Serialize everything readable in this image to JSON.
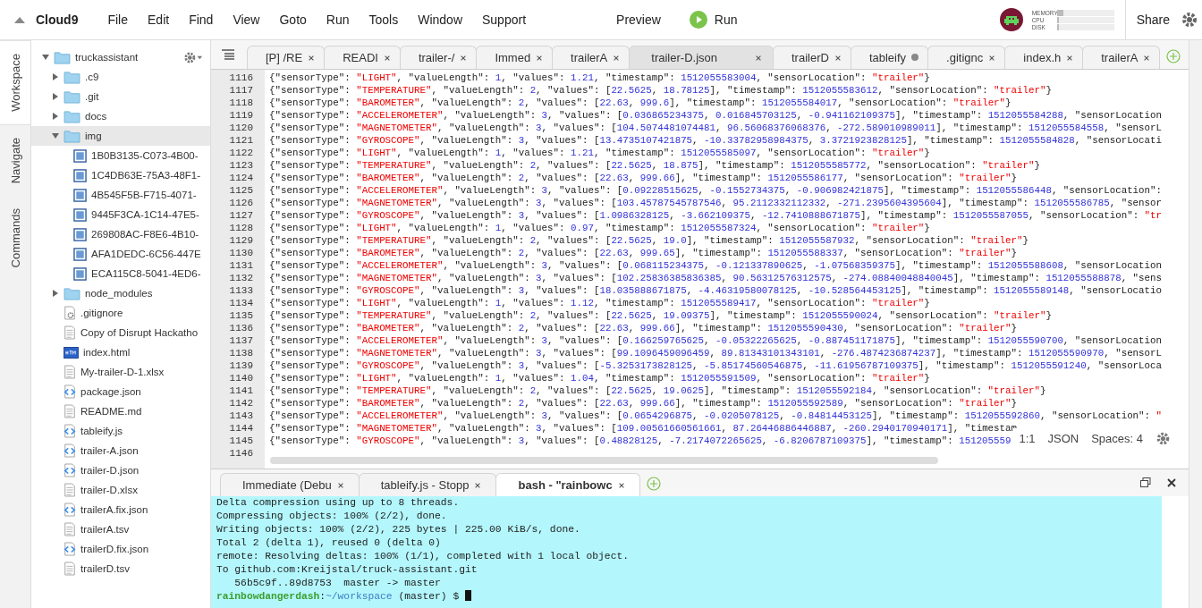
{
  "menubar": {
    "logo": "Cloud9",
    "items": [
      "File",
      "Edit",
      "Find",
      "View",
      "Goto",
      "Run",
      "Tools",
      "Window",
      "Support"
    ],
    "preview": "Preview",
    "run": "Run",
    "meters": [
      {
        "label": "MEMORY",
        "level": 0.12
      },
      {
        "label": "CPU",
        "level": 0.04
      },
      {
        "label": "DISK",
        "level": 0.03
      }
    ],
    "share": "Share"
  },
  "side_tabs": [
    {
      "label": "Workspace",
      "selected": true
    },
    {
      "label": "Navigate",
      "selected": false
    },
    {
      "label": "Commands",
      "selected": false
    }
  ],
  "file_tree": [
    {
      "name": "truckassistant",
      "kind": "folder",
      "expanded": true,
      "selected": false,
      "children": [
        {
          "name": ".c9",
          "kind": "folder",
          "expanded": false,
          "selected": false
        },
        {
          "name": ".git",
          "kind": "folder",
          "expanded": false,
          "selected": false
        },
        {
          "name": "docs",
          "kind": "folder",
          "expanded": false,
          "selected": false
        },
        {
          "name": "img",
          "kind": "folder",
          "expanded": true,
          "selected": true,
          "children": [
            {
              "name": "1B0B3135-C073-4B00-",
              "kind": "image",
              "selected": false
            },
            {
              "name": "1C4DB63E-75A3-48F1-",
              "kind": "image",
              "selected": false
            },
            {
              "name": "4B545F5B-F715-4071-",
              "kind": "image",
              "selected": false
            },
            {
              "name": "9445F3CA-1C14-47E5-",
              "kind": "image",
              "selected": false
            },
            {
              "name": "269808AC-F8E6-4B10-",
              "kind": "image",
              "selected": false
            },
            {
              "name": "AFA1DEDC-6C56-447E",
              "kind": "image",
              "selected": false
            },
            {
              "name": "ECA115C8-5041-4ED6-",
              "kind": "image",
              "selected": false
            }
          ]
        },
        {
          "name": "node_modules",
          "kind": "folder",
          "expanded": false,
          "selected": false
        },
        {
          "name": ".gitignore",
          "kind": "config",
          "selected": false
        },
        {
          "name": "Copy of Disrupt Hackatho",
          "kind": "text",
          "selected": false
        },
        {
          "name": "index.html",
          "kind": "html",
          "selected": false
        },
        {
          "name": "My-trailer-D-1.xlsx",
          "kind": "text",
          "selected": false
        },
        {
          "name": "package.json",
          "kind": "code",
          "selected": false
        },
        {
          "name": "README.md",
          "kind": "text",
          "selected": false
        },
        {
          "name": "tableify.js",
          "kind": "code",
          "selected": false
        },
        {
          "name": "trailer-A.json",
          "kind": "code",
          "selected": false
        },
        {
          "name": "trailer-D.json",
          "kind": "code",
          "selected": false
        },
        {
          "name": "trailer-D.xlsx",
          "kind": "text",
          "selected": false
        },
        {
          "name": "trailerA.fix.json",
          "kind": "code",
          "selected": false
        },
        {
          "name": "trailerA.tsv",
          "kind": "text",
          "selected": false
        },
        {
          "name": "trailerD.fix.json",
          "kind": "code",
          "selected": false
        },
        {
          "name": "trailerD.tsv",
          "kind": "text",
          "selected": false
        }
      ]
    }
  ],
  "editor": {
    "tabs": [
      {
        "label": "[P] /RE",
        "selected": false,
        "modified": false
      },
      {
        "label": "READI",
        "selected": false,
        "modified": false
      },
      {
        "label": "trailer-/",
        "selected": false,
        "modified": false
      },
      {
        "label": "Immed",
        "selected": false,
        "modified": false
      },
      {
        "label": "trailerA",
        "selected": false,
        "modified": false
      },
      {
        "label": "trailer-D.json",
        "selected": true,
        "modified": false
      },
      {
        "label": "trailerD",
        "selected": false,
        "modified": false
      },
      {
        "label": "tableify",
        "selected": false,
        "modified": true
      },
      {
        "label": ".gitignc",
        "selected": false,
        "modified": false
      },
      {
        "label": "index.h",
        "selected": false,
        "modified": false
      },
      {
        "label": "trailerA",
        "selected": false,
        "modified": false
      }
    ],
    "lines": [
      {
        "number": "1116",
        "text": "{\"sensorType\": \"LIGHT\", \"valueLength\": 1, \"values\": 1.21, \"timestamp\": 1512055583004, \"sensorLocation\": \"trailer\"}"
      },
      {
        "number": "1117",
        "text": "{\"sensorType\": \"TEMPERATURE\", \"valueLength\": 2, \"values\": [22.5625, 18.78125], \"timestamp\": 1512055583612, \"sensorLocation\": \"trailer\"}"
      },
      {
        "number": "1118",
        "text": "{\"sensorType\": \"BAROMETER\", \"valueLength\": 2, \"values\": [22.63, 999.6], \"timestamp\": 1512055584017, \"sensorLocation\": \"trailer\"}"
      },
      {
        "number": "1119",
        "text": "{\"sensorType\": \"ACCELEROMETER\", \"valueLength\": 3, \"values\": [0.036865234375, 0.016845703125, -0.941162109375], \"timestamp\": 1512055584288, \"sensorLocation"
      },
      {
        "number": "1120",
        "text": "{\"sensorType\": \"MAGNETOMETER\", \"valueLength\": 3, \"values\": [104.5074481074481, 96.56068376068376, -272.589010989011], \"timestamp\": 1512055584558, \"sensorL"
      },
      {
        "number": "1121",
        "text": "{\"sensorType\": \"GYROSCOPE\", \"valueLength\": 3, \"values\": [13.4735107421875, -10.33782958984375, 3.3721923828125], \"timestamp\": 1512055584828, \"sensorLocati"
      },
      {
        "number": "1122",
        "text": "{\"sensorType\": \"LIGHT\", \"valueLength\": 1, \"values\": 1.21, \"timestamp\": 1512055585097, \"sensorLocation\": \"trailer\"}"
      },
      {
        "number": "1123",
        "text": "{\"sensorType\": \"TEMPERATURE\", \"valueLength\": 2, \"values\": [22.5625, 18.875], \"timestamp\": 1512055585772, \"sensorLocation\": \"trailer\"}"
      },
      {
        "number": "1124",
        "text": "{\"sensorType\": \"BAROMETER\", \"valueLength\": 2, \"values\": [22.63, 999.66], \"timestamp\": 1512055586177, \"sensorLocation\": \"trailer\"}"
      },
      {
        "number": "1125",
        "text": "{\"sensorType\": \"ACCELEROMETER\", \"valueLength\": 3, \"values\": [0.09228515625, -0.1552734375, -0.906982421875], \"timestamp\": 1512055586448, \"sensorLocation\":"
      },
      {
        "number": "1126",
        "text": "{\"sensorType\": \"MAGNETOMETER\", \"valueLength\": 3, \"values\": [103.45787545787546, 95.2112332112332, -271.2395604395604], \"timestamp\": 1512055586785, \"sensor"
      },
      {
        "number": "1127",
        "text": "{\"sensorType\": \"GYROSCOPE\", \"valueLength\": 3, \"values\": [1.0986328125, -3.662109375, -12.7410888671875], \"timestamp\": 1512055587055, \"sensorLocation\": \"tr"
      },
      {
        "number": "1128",
        "text": "{\"sensorType\": \"LIGHT\", \"valueLength\": 1, \"values\": 0.97, \"timestamp\": 1512055587324, \"sensorLocation\": \"trailer\"}"
      },
      {
        "number": "1129",
        "text": "{\"sensorType\": \"TEMPERATURE\", \"valueLength\": 2, \"values\": [22.5625, 19.0], \"timestamp\": 1512055587932, \"sensorLocation\": \"trailer\"}"
      },
      {
        "number": "1130",
        "text": "{\"sensorType\": \"BAROMETER\", \"valueLength\": 2, \"values\": [22.63, 999.65], \"timestamp\": 1512055588337, \"sensorLocation\": \"trailer\"}"
      },
      {
        "number": "1131",
        "text": "{\"sensorType\": \"ACCELEROMETER\", \"valueLength\": 3, \"values\": [0.068115234375, -0.121337890625, -1.07568359375], \"timestamp\": 1512055588608, \"sensorLocation"
      },
      {
        "number": "1132",
        "text": "{\"sensorType\": \"MAGNETOMETER\", \"valueLength\": 3, \"values\": [102.25836385836385, 90.56312576312575, -274.08840048840045], \"timestamp\": 1512055588878, \"sens"
      },
      {
        "number": "1133",
        "text": "{\"sensorType\": \"GYROSCOPE\", \"valueLength\": 3, \"values\": [18.035888671875, -4.46319580078125, -10.528564453125], \"timestamp\": 1512055589148, \"sensorLocatio"
      },
      {
        "number": "1134",
        "text": "{\"sensorType\": \"LIGHT\", \"valueLength\": 1, \"values\": 1.12, \"timestamp\": 1512055589417, \"sensorLocation\": \"trailer\"}"
      },
      {
        "number": "1135",
        "text": "{\"sensorType\": \"TEMPERATURE\", \"valueLength\": 2, \"values\": [22.5625, 19.09375], \"timestamp\": 1512055590024, \"sensorLocation\": \"trailer\"}"
      },
      {
        "number": "1136",
        "text": "{\"sensorType\": \"BAROMETER\", \"valueLength\": 2, \"values\": [22.63, 999.66], \"timestamp\": 1512055590430, \"sensorLocation\": \"trailer\"}"
      },
      {
        "number": "1137",
        "text": "{\"sensorType\": \"ACCELEROMETER\", \"valueLength\": 3, \"values\": [0.166259765625, -0.05322265625, -0.887451171875], \"timestamp\": 1512055590700, \"sensorLocation"
      },
      {
        "number": "1138",
        "text": "{\"sensorType\": \"MAGNETOMETER\", \"valueLength\": 3, \"values\": [99.1096459096459, 89.81343101343101, -276.4874236874237], \"timestamp\": 1512055590970, \"sensorL"
      },
      {
        "number": "1139",
        "text": "{\"sensorType\": \"GYROSCOPE\", \"valueLength\": 3, \"values\": [-5.3253173828125, -5.85174560546875, -11.61956787109375], \"timestamp\": 1512055591240, \"sensorLoca"
      },
      {
        "number": "1140",
        "text": "{\"sensorType\": \"LIGHT\", \"valueLength\": 1, \"values\": 1.04, \"timestamp\": 1512055591509, \"sensorLocation\": \"trailer\"}"
      },
      {
        "number": "1141",
        "text": "{\"sensorType\": \"TEMPERATURE\", \"valueLength\": 2, \"values\": [22.5625, 19.0625], \"timestamp\": 1512055592184, \"sensorLocation\": \"trailer\"}"
      },
      {
        "number": "1142",
        "text": "{\"sensorType\": \"BAROMETER\", \"valueLength\": 2, \"values\": [22.63, 999.66], \"timestamp\": 1512055592589, \"sensorLocation\": \"trailer\"}"
      },
      {
        "number": "1143",
        "text": "{\"sensorType\": \"ACCELEROMETER\", \"valueLength\": 3, \"values\": [0.0654296875, -0.0205078125, -0.84814453125], \"timestamp\": 1512055592860, \"sensorLocation\": \""
      },
      {
        "number": "1144",
        "text": "{\"sensorType\": \"MAGNETOMETER\", \"valueLength\": 3, \"values\": [109.00561660561661, 87.26446886446887, -260.2940170940171], \"timestam"
      },
      {
        "number": "1145",
        "text": "{\"sensorType\": \"GYROSCOPE\", \"valueLength\": 3, \"values\": [0.48828125, -7.2174072265625, -6.8206787109375], \"timestamp\": 151205559"
      },
      {
        "number": "1146"
      }
    ],
    "status": {
      "position": "1:1",
      "mode": "JSON",
      "indent": "Spaces: 4"
    }
  },
  "console": {
    "tabs": [
      {
        "label": "Immediate (Debu",
        "selected": false
      },
      {
        "label": "tableify.js - Stopp",
        "selected": false
      },
      {
        "label": "bash - \"rainbowc",
        "selected": true
      }
    ],
    "lines": [
      "Delta compression using up to 8 threads.",
      "Compressing objects: 100% (2/2), done.",
      "Writing objects: 100% (2/2), 225 bytes | 225.00 KiB/s, done.",
      "Total 2 (delta 1), reused 0 (delta 0)",
      "remote: Resolving deltas: 100% (1/1), completed with 1 local object.",
      "To github.com:Kreijstal/truck-assistant.git",
      "   56b5c9f..89d8753  master -> master"
    ],
    "prompt": {
      "user": "rainbowdangerdash",
      "separator": ":",
      "path": "~/workspace",
      "suffix": " (master) $ "
    }
  }
}
